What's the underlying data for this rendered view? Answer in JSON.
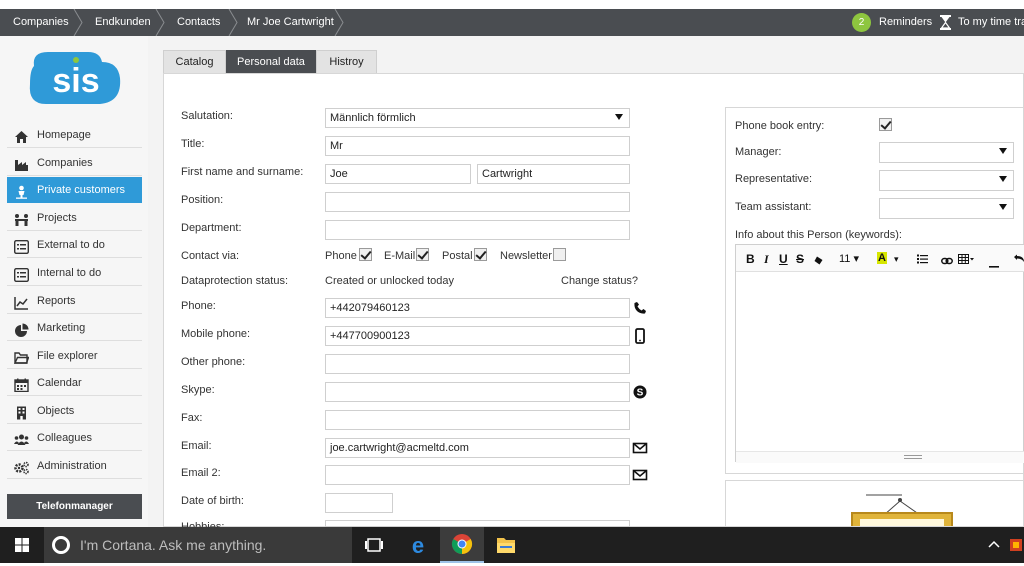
{
  "topbar": {
    "breadcrumbs": [
      "Companies",
      "Endkunden",
      "Contacts",
      "Mr Joe Cartwright"
    ],
    "reminders_count": "2",
    "reminders_label": "Reminders",
    "time_tracking_label": "To my time tra"
  },
  "logo": {
    "text": "SIS"
  },
  "sidebar": {
    "items": [
      {
        "label": "Homepage",
        "icon": "home-icon"
      },
      {
        "label": "Companies",
        "icon": "factory-icon"
      },
      {
        "label": "Private customers",
        "icon": "person-icon",
        "active": true
      },
      {
        "label": "Projects",
        "icon": "meeting-icon"
      },
      {
        "label": "External to do",
        "icon": "list-icon"
      },
      {
        "label": "Internal to do",
        "icon": "list-icon"
      },
      {
        "label": "Reports",
        "icon": "chart-icon"
      },
      {
        "label": "Marketing",
        "icon": "pie-icon"
      },
      {
        "label": "File explorer",
        "icon": "folder-icon"
      },
      {
        "label": "Calendar",
        "icon": "calendar-icon"
      },
      {
        "label": "Objects",
        "icon": "building-icon"
      },
      {
        "label": "Colleagues",
        "icon": "group-icon"
      },
      {
        "label": "Administration",
        "icon": "gears-icon"
      }
    ],
    "telefon_button": "Telefonmanager"
  },
  "tabs": [
    {
      "label": "Catalog",
      "active": false
    },
    {
      "label": "Personal data",
      "active": true
    },
    {
      "label": "Histroy",
      "active": false
    }
  ],
  "form": {
    "salutation_label": "Salutation:",
    "salutation_value": "Männlich förmlich",
    "title_label": "Title:",
    "title_value": "Mr",
    "name_label": "First name and surname:",
    "first_name": "Joe",
    "surname": "Cartwright",
    "position_label": "Position:",
    "position_value": "",
    "department_label": "Department:",
    "department_value": "",
    "contact_via_label": "Contact via:",
    "contact_options": [
      {
        "label": "Phone",
        "checked": true
      },
      {
        "label": "E-Mail",
        "checked": true
      },
      {
        "label": "Postal",
        "checked": true
      },
      {
        "label": "Newsletter",
        "checked": false
      }
    ],
    "dataprotection_label": "Dataprotection status:",
    "dataprotection_value": "Created or unlocked today",
    "change_status_link": "Change status?",
    "phone_label": "Phone:",
    "phone_value": "+442079460123",
    "mobile_label": "Mobile phone:",
    "mobile_value": "+447700900123",
    "other_phone_label": "Other phone:",
    "other_phone_value": "",
    "skype_label": "Skype:",
    "skype_value": "",
    "fax_label": "Fax:",
    "fax_value": "",
    "email_label": "Email:",
    "email_value": "joe.cartwright@acmeltd.com",
    "email2_label": "Email 2:",
    "email2_value": "",
    "dob_label": "Date of birth:",
    "dob_value": "",
    "hobbies_label": "Hobbies:"
  },
  "right": {
    "phonebook_label": "Phone book entry:",
    "phonebook_checked": true,
    "manager_label": "Manager:",
    "representative_label": "Representative:",
    "team_assistant_label": "Team assistant:",
    "info_label": "Info about this Person (keywords):",
    "editor_font_size": "11"
  },
  "taskbar": {
    "cortana_placeholder": "I'm Cortana. Ask me anything."
  },
  "colors": {
    "topbar": "#4a4d51",
    "accent": "#2f9ad8",
    "badge": "#8ec63f"
  }
}
